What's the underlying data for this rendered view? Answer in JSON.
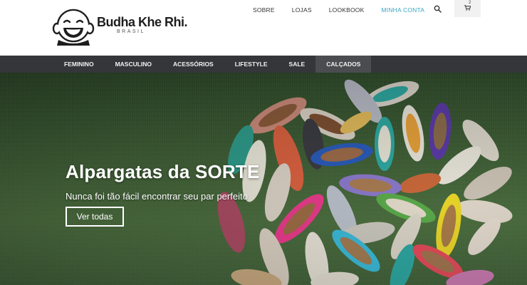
{
  "brand": {
    "name": "Budha Khe Rhi.",
    "sub": "BRASIL"
  },
  "topnav": {
    "items": [
      {
        "label": "SOBRE"
      },
      {
        "label": "LOJAS"
      },
      {
        "label": "LOOKBOOK"
      },
      {
        "label": "MINHA CONTA"
      }
    ],
    "cart_count": "2"
  },
  "categories": [
    {
      "label": "FEMININO"
    },
    {
      "label": "MASCULINO"
    },
    {
      "label": "ACESSÓRIOS"
    },
    {
      "label": "LIFESTYLE"
    },
    {
      "label": "SALE"
    },
    {
      "label": "CALÇADOS",
      "active": true
    }
  ],
  "hero": {
    "title": "Alpargatas da SORTE",
    "subtitle": "Nunca foi tão fácil encontrar seu par perfeito",
    "button": "Ver todas"
  },
  "colors": {
    "account_link": "#3aa5c4",
    "category_bar": "#34363a",
    "active_category": "#4a4c50",
    "grass": "#3c5a34"
  }
}
